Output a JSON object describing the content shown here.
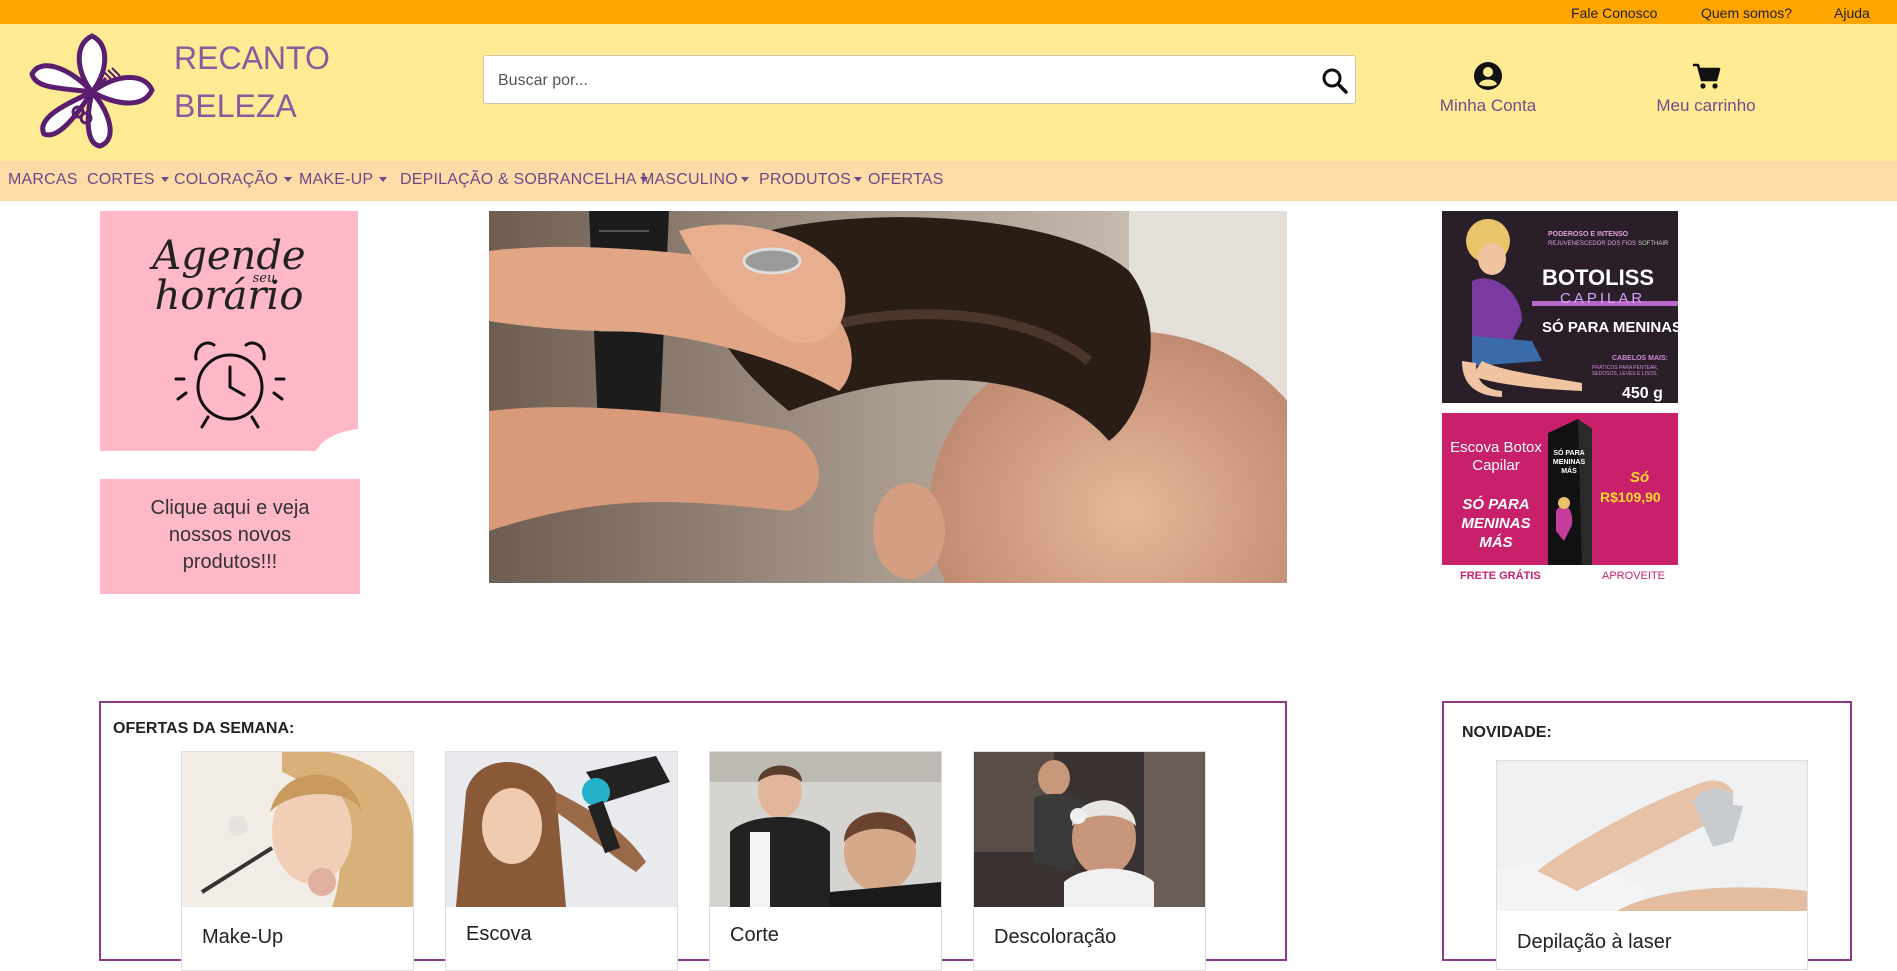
{
  "topbar": {
    "links": [
      "Fale Conosco",
      "Quem somos?",
      "Ajuda"
    ]
  },
  "brand": {
    "line1": "RECANTO",
    "line2": "BELEZA"
  },
  "search": {
    "placeholder": "Buscar por..."
  },
  "account": {
    "label": "Minha Conta"
  },
  "cart": {
    "label": "Meu carrinho"
  },
  "nav": [
    "MARCAS",
    "CORTES",
    "COLORAÇÃO",
    "MAKE-UP",
    "DEPILAÇÃO & SOBRANCELHA",
    "MASCULINO",
    "PRODUTOS",
    "OFERTAS"
  ],
  "promo": {
    "agende_line1": "Agende",
    "agende_small": "seu",
    "agende_line2": "horário",
    "clique_text": "Clique aqui e veja nossos novos produtos!!!"
  },
  "ads": {
    "botoliss": {
      "tag1": "PODEROSO E INTENSO",
      "tag2": "REJUVENESCEDOR DOS FIOS",
      "brand": "SOFTHAIR",
      "title": "BOTOLISS",
      "subtitle": "CAPILAR",
      "slogan": "SÓ PARA MENINAS MÁS",
      "small1": "CABELOS MAIS:",
      "small2": "PRÁTICOS PARA PENTEAR, SEDOSOS, LEVES E LISOS.",
      "weight": "450 g"
    },
    "escova": {
      "title1": "Escova Botox",
      "title2": "Capilar",
      "slogan1": "SÓ PARA",
      "slogan2": "MENINAS",
      "slogan3": "MÁS",
      "so": "Só",
      "price": "R$109,90",
      "frete": "FRETE GRÁTIS",
      "aproveite": "APROVEITE",
      "box_text": "SÓ PARA MENINAS MÁS"
    }
  },
  "ofertas": {
    "title": "OFERTAS DA SEMANA:",
    "cards": [
      "Make-Up",
      "Escova",
      "Corte",
      "Descoloração"
    ]
  },
  "novidade": {
    "title": "NOVIDADE:",
    "card": "Depilação à laser"
  },
  "colors": {
    "topbar": "#ffa500",
    "header": "#ffeb94",
    "nav": "#ffdba8",
    "brand": "#8b5a9e",
    "accent": "#8b3a8b",
    "pink": "#ffb8c8"
  }
}
